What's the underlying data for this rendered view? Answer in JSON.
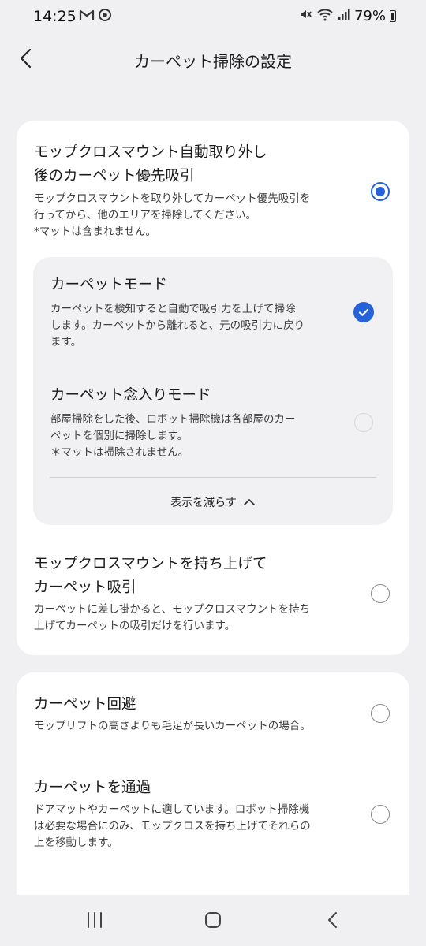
{
  "status_bar": {
    "time": "14:25",
    "battery": "79%",
    "icons": [
      "gmail-icon",
      "sync-icon",
      "mute-icon",
      "wifi-icon",
      "signal-icon",
      "battery-icon"
    ]
  },
  "header": {
    "title": "カーペット掃除の設定"
  },
  "card1": {
    "option1": {
      "title_line1": "モップクロスマウント自動取り外し",
      "title_line2": "後のカーペット優先吸引",
      "desc_line1": "モップクロスマウントを取り外してカーペット優先吸引を",
      "desc_line2": "行ってから、他のエリアを掃除してください。",
      "desc_line3": "*マットは含まれません。",
      "selected": true
    },
    "subpanel": {
      "mode1": {
        "title": "カーペットモード",
        "desc_line1": "カーペットを検知すると自動で吸引力を上げて掃除",
        "desc_line2": "します。カーペットから離れると、元の吸引力に戻り",
        "desc_line3": "ます。",
        "checked": true
      },
      "mode2": {
        "title": "カーペット念入りモード",
        "desc_line1": "部屋掃除をした後、ロボット掃除機は各部屋のカー",
        "desc_line2": "ペットを個別に掃除します。",
        "desc_line3": "＊マットは掃除されません。",
        "checked": false
      },
      "show_less_label": "表示を減らす"
    },
    "option2": {
      "title_line1": "モップクロスマウントを持ち上げて",
      "title_line2": "カーペット吸引",
      "desc_line1": "カーペットに差し掛かると、モップクロスマウントを持ち",
      "desc_line2": "上げてカーペットの吸引だけを行います。",
      "selected": false
    }
  },
  "card2": {
    "option3": {
      "title": "カーペット回避",
      "desc_line1": "モップリフトの高さよりも毛足が長いカーペットの場合。",
      "selected": false
    },
    "option4": {
      "title": "カーペットを通過",
      "desc_line1": "ドアマットやカーペットに適しています。ロボット掃除機",
      "desc_line2": "は必要な場合にのみ、モップクロスを持ち上げてそれらの",
      "desc_line3": "上を移動します。",
      "selected": false
    }
  },
  "colors": {
    "accent": "#2562d9",
    "background": "#f0f0f3",
    "card": "#ffffff",
    "subpanel": "#f1f1f3"
  }
}
